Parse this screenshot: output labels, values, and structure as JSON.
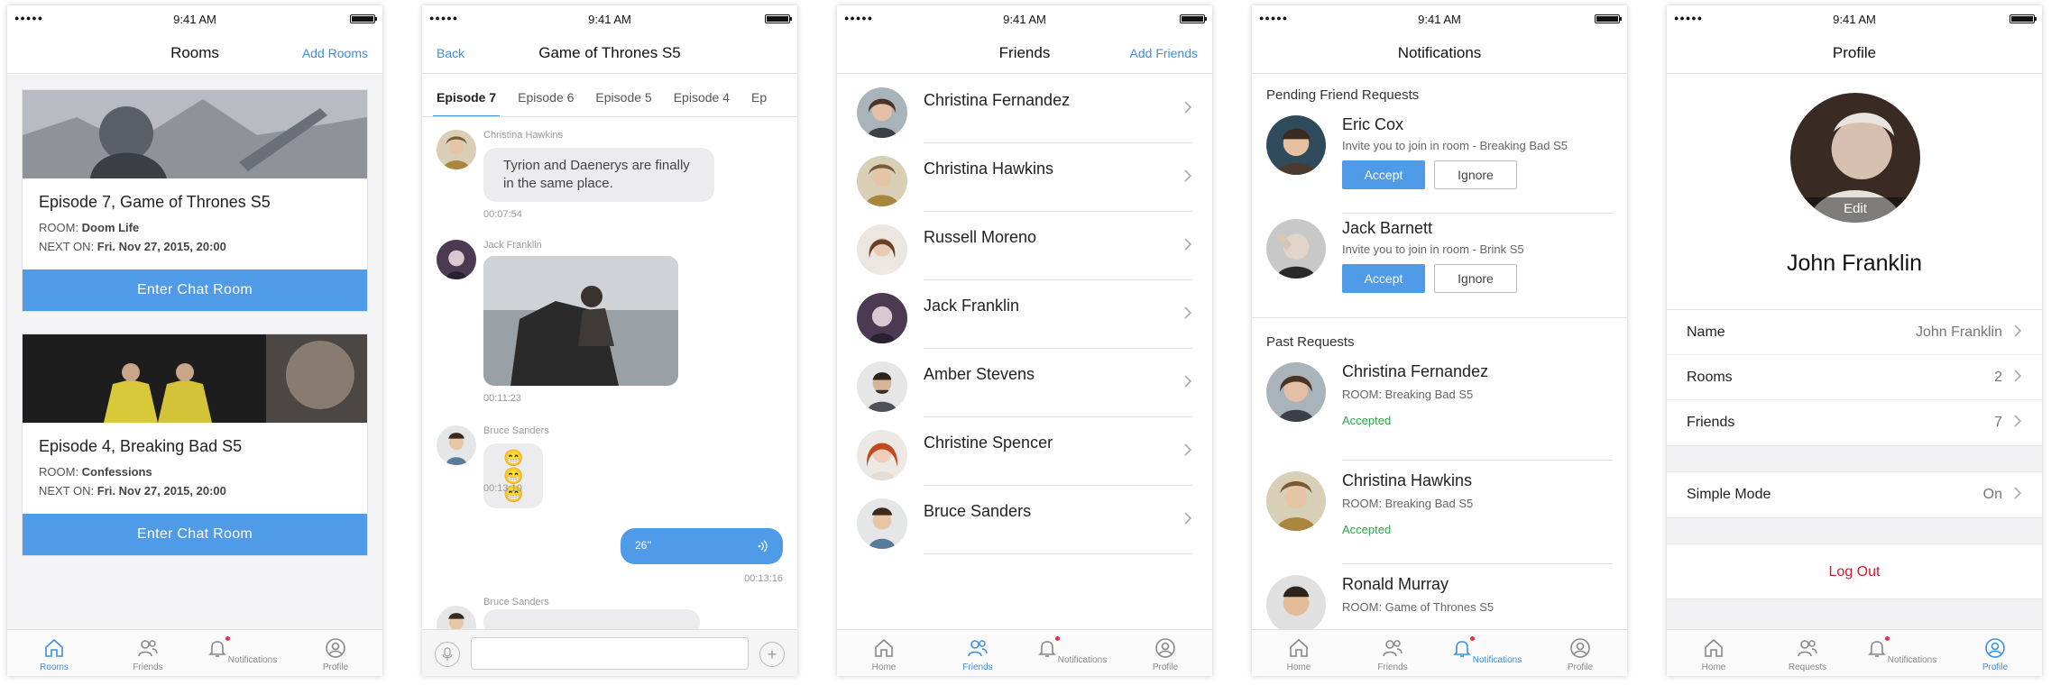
{
  "status": {
    "time": "9:41 AM",
    "signal": "●●●●●"
  },
  "tabs": {
    "home": "Home",
    "rooms": "Rooms",
    "friends": "Friends",
    "notifications": "Notifications",
    "profile": "Profile",
    "requests": "Requests"
  },
  "rooms_screen": {
    "title": "Rooms",
    "add_label": "Add Rooms",
    "cards": [
      {
        "title": "Episode 7, Game of Thrones S5",
        "room_prefix": "ROOM: ",
        "room": "Doom Life",
        "next_prefix": "NEXT ON: ",
        "next": "Fri. Nov 27, 2015, 20:00",
        "button": "Enter Chat Room"
      },
      {
        "title": "Episode 4, Breaking Bad S5",
        "room_prefix": "ROOM: ",
        "room": "Confessions",
        "next_prefix": "NEXT ON: ",
        "next": "Fri. Nov 27, 2015, 20:00",
        "button": "Enter Chat Room"
      }
    ]
  },
  "chat_screen": {
    "back_label": "Back",
    "title": "Game of Thrones S5",
    "episodes": [
      "Episode 7",
      "Episode 6",
      "Episode 5",
      "Episode 4",
      "Ep"
    ],
    "messages": [
      {
        "name": "Christina Hawkins",
        "text": "Tyrion and Daenerys are finally in the same place.",
        "time": "00:07:54"
      },
      {
        "name": "Jack Franklin",
        "time": "00:11:23"
      },
      {
        "name": "Bruce Sanders",
        "emoji": "😁😁😁",
        "time": "00:13:10"
      },
      {
        "voice": "26’’",
        "time": "00:13:16"
      },
      {
        "name": "Bruce Sanders"
      }
    ]
  },
  "friends_screen": {
    "title": "Friends",
    "add_label": "Add Friends",
    "friends": [
      "Christina Fernandez",
      "Christina Hawkins",
      "Russell Moreno",
      "Jack Franklin",
      "Amber Stevens",
      "Christine Spencer",
      "Bruce Sanders"
    ]
  },
  "notifications_screen": {
    "title": "Notifications",
    "pending_header": "Pending Friend Requests",
    "past_header": "Past Requests",
    "accept_label": "Accept",
    "ignore_label": "Ignore",
    "pending": [
      {
        "name": "Eric Cox",
        "text": "Invite you to join in room - Breaking Bad S5"
      },
      {
        "name": "Jack Barnett",
        "text": "Invite you to join in room - Brink S5"
      }
    ],
    "past": [
      {
        "name": "Christina Fernandez",
        "room": "ROOM: Breaking Bad S5",
        "status": "Accepted"
      },
      {
        "name": "Christina Hawkins",
        "room": "ROOM: Breaking Bad S5",
        "status": "Accepted"
      },
      {
        "name": "Ronald Murray",
        "room": "ROOM: Game of Thrones S5"
      }
    ]
  },
  "profile_screen": {
    "title": "Profile",
    "edit_label": "Edit",
    "name": "John Franklin",
    "rows": [
      {
        "label": "Name",
        "value": "John Franklin"
      },
      {
        "label": "Rooms",
        "value": "2"
      },
      {
        "label": "Friends",
        "value": "7"
      }
    ],
    "simple_mode": {
      "label": "Simple Mode",
      "value": "On"
    },
    "logout": "Log Out"
  },
  "colors": {
    "accent": "#4f9be8",
    "danger": "#d0192b",
    "success": "#28a745"
  }
}
